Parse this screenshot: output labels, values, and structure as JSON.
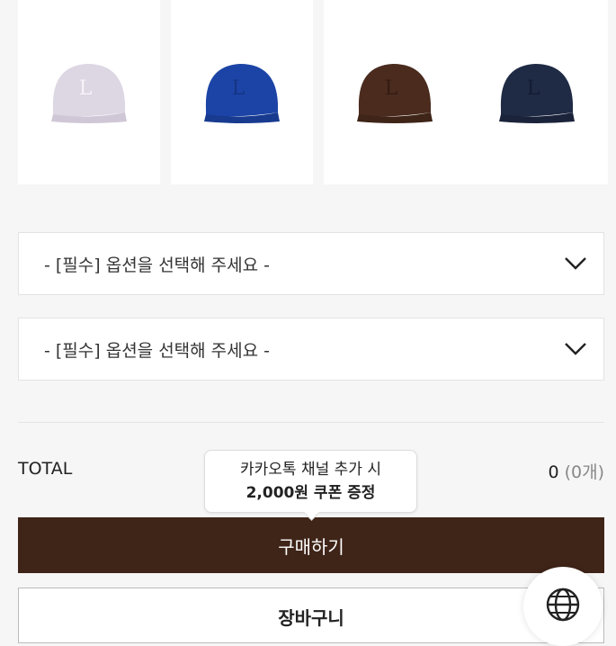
{
  "products": [
    {
      "name": "lavender-cap",
      "color": "#ddd6e3",
      "accent": "#f7f3f9"
    },
    {
      "name": "blue-cap",
      "color": "#1c44a6",
      "accent": "#143585"
    },
    {
      "name": "brown-cap",
      "color": "#4a2b1e",
      "accent": "#341c12"
    },
    {
      "name": "navy-cap",
      "color": "#1f2a44",
      "accent": "#151d33"
    }
  ],
  "options": [
    {
      "placeholder": "- [필수] 옵션을 선택해 주세요 -",
      "icon": "chevron-down-icon"
    },
    {
      "placeholder": "- [필수] 옵션을 선택해 주세요 -",
      "icon": "chevron-down-icon"
    }
  ],
  "total": {
    "label": "TOTAL",
    "amount": "0",
    "count": "(0개)"
  },
  "tooltip": {
    "line1": "카카오톡 채널 추가 시",
    "line2": "2,000원 쿠폰 증정"
  },
  "buttons": {
    "buy": "구매하기",
    "cart": "장바구니"
  },
  "colors": {
    "buy_bg": "#3f2418",
    "page_bg": "#f6f6f6"
  },
  "icons": {
    "language": "globe-icon"
  }
}
